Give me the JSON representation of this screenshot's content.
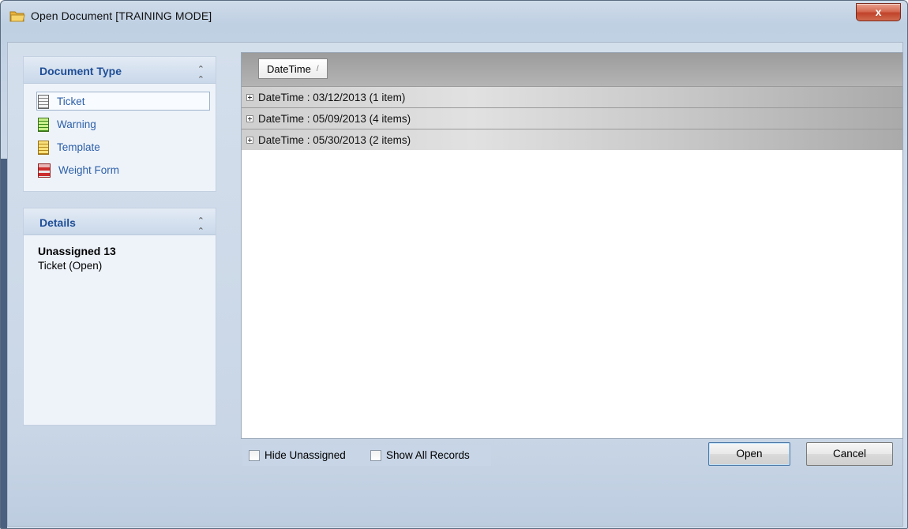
{
  "window": {
    "title": "Open Document [TRAINING MODE]",
    "close_label": "x"
  },
  "document_type_panel": {
    "title": "Document Type",
    "collapse_icon": "⌃",
    "items": [
      {
        "label": "Ticket",
        "icon": "ticket-doc-icon",
        "selected": true
      },
      {
        "label": "Warning",
        "icon": "warning-doc-icon"
      },
      {
        "label": "Template",
        "icon": "template-doc-icon"
      },
      {
        "label": "Weight Form",
        "icon": "weight-form-icon"
      }
    ]
  },
  "details_panel": {
    "title": "Details",
    "name": "Unassigned 13",
    "status": "Ticket (Open)"
  },
  "grid": {
    "group_by_column": "DateTime",
    "sort_indicator": "/",
    "groups": [
      {
        "label": "DateTime : 03/12/2013 (1 item)"
      },
      {
        "label": "DateTime : 05/09/2013 (4 items)"
      },
      {
        "label": "DateTime : 05/30/2013 (2 items)"
      }
    ]
  },
  "options": {
    "hide_unassigned": "Hide Unassigned",
    "show_all_records": "Show All Records"
  },
  "buttons": {
    "open": "Open",
    "cancel": "Cancel"
  }
}
